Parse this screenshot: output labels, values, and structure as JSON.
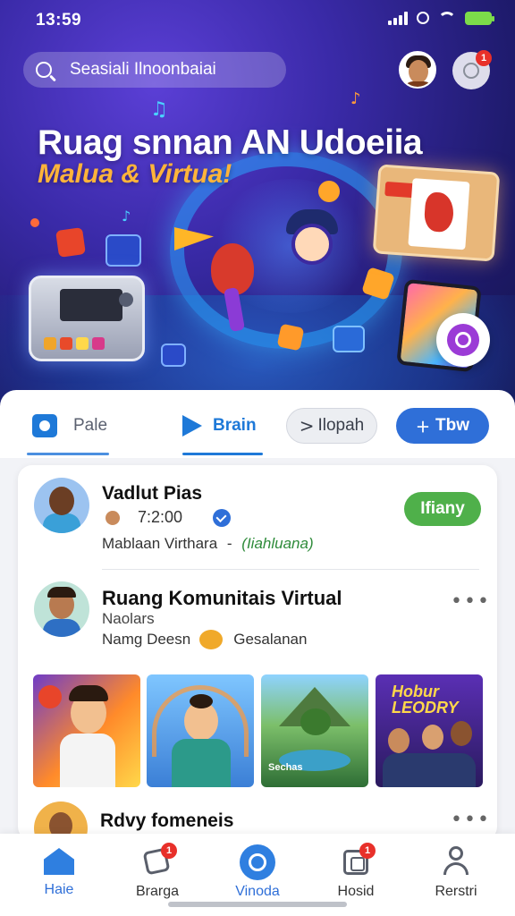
{
  "status_bar": {
    "time": "13:59"
  },
  "header": {
    "search_placeholder": "Seasiali Ilnoonbaiai",
    "notification_count": "1"
  },
  "hero": {
    "title": "Ruag snnan AN Udoeiia",
    "subtitle": "Malua & Virtua!"
  },
  "tabs": [
    {
      "label": "Pale",
      "icon": "camera-icon"
    },
    {
      "label": "Brain",
      "icon": "arrow-icon"
    },
    {
      "label": "Ilopah",
      "icon": "chevron-right-icon"
    },
    {
      "label": "Tbw",
      "icon": "plus-icon"
    }
  ],
  "feed": {
    "post1": {
      "title": "Vadlut Pias",
      "time": "7:2:00",
      "description": "Mablaan Virthara",
      "separator": "-",
      "link": "(Iiahluana)",
      "action_label": "Ifiany"
    },
    "post2": {
      "title": "Ruang Komunitais Virtual",
      "subtitle": "Naolars",
      "meta_left": "Namg Deesn",
      "meta_right": "Gesalanan"
    },
    "thumbnails": [
      {
        "kind": "illustration",
        "caption": ""
      },
      {
        "kind": "portrait-rainbow",
        "caption": ""
      },
      {
        "kind": "landscape",
        "caption": "Sechas"
      },
      {
        "kind": "poster",
        "caption": "Hobur LEODRY"
      }
    ],
    "post3": {
      "title": "Rdvy fomeneis"
    }
  },
  "bottom_nav": [
    {
      "label": "Haie",
      "icon": "home-icon",
      "active": true
    },
    {
      "label": "Brarga",
      "icon": "tag-icon",
      "badge": "1"
    },
    {
      "label": "Vinoda",
      "icon": "video-icon",
      "active": true
    },
    {
      "label": "Hosid",
      "icon": "gallery-icon",
      "badge": "1"
    },
    {
      "label": "Rerstri",
      "icon": "profile-icon"
    }
  ],
  "colors": {
    "accent": "#2f6fd8",
    "follow": "#4fb04a",
    "badge": "#e8302a",
    "hero_subtitle": "#ffb43a"
  }
}
